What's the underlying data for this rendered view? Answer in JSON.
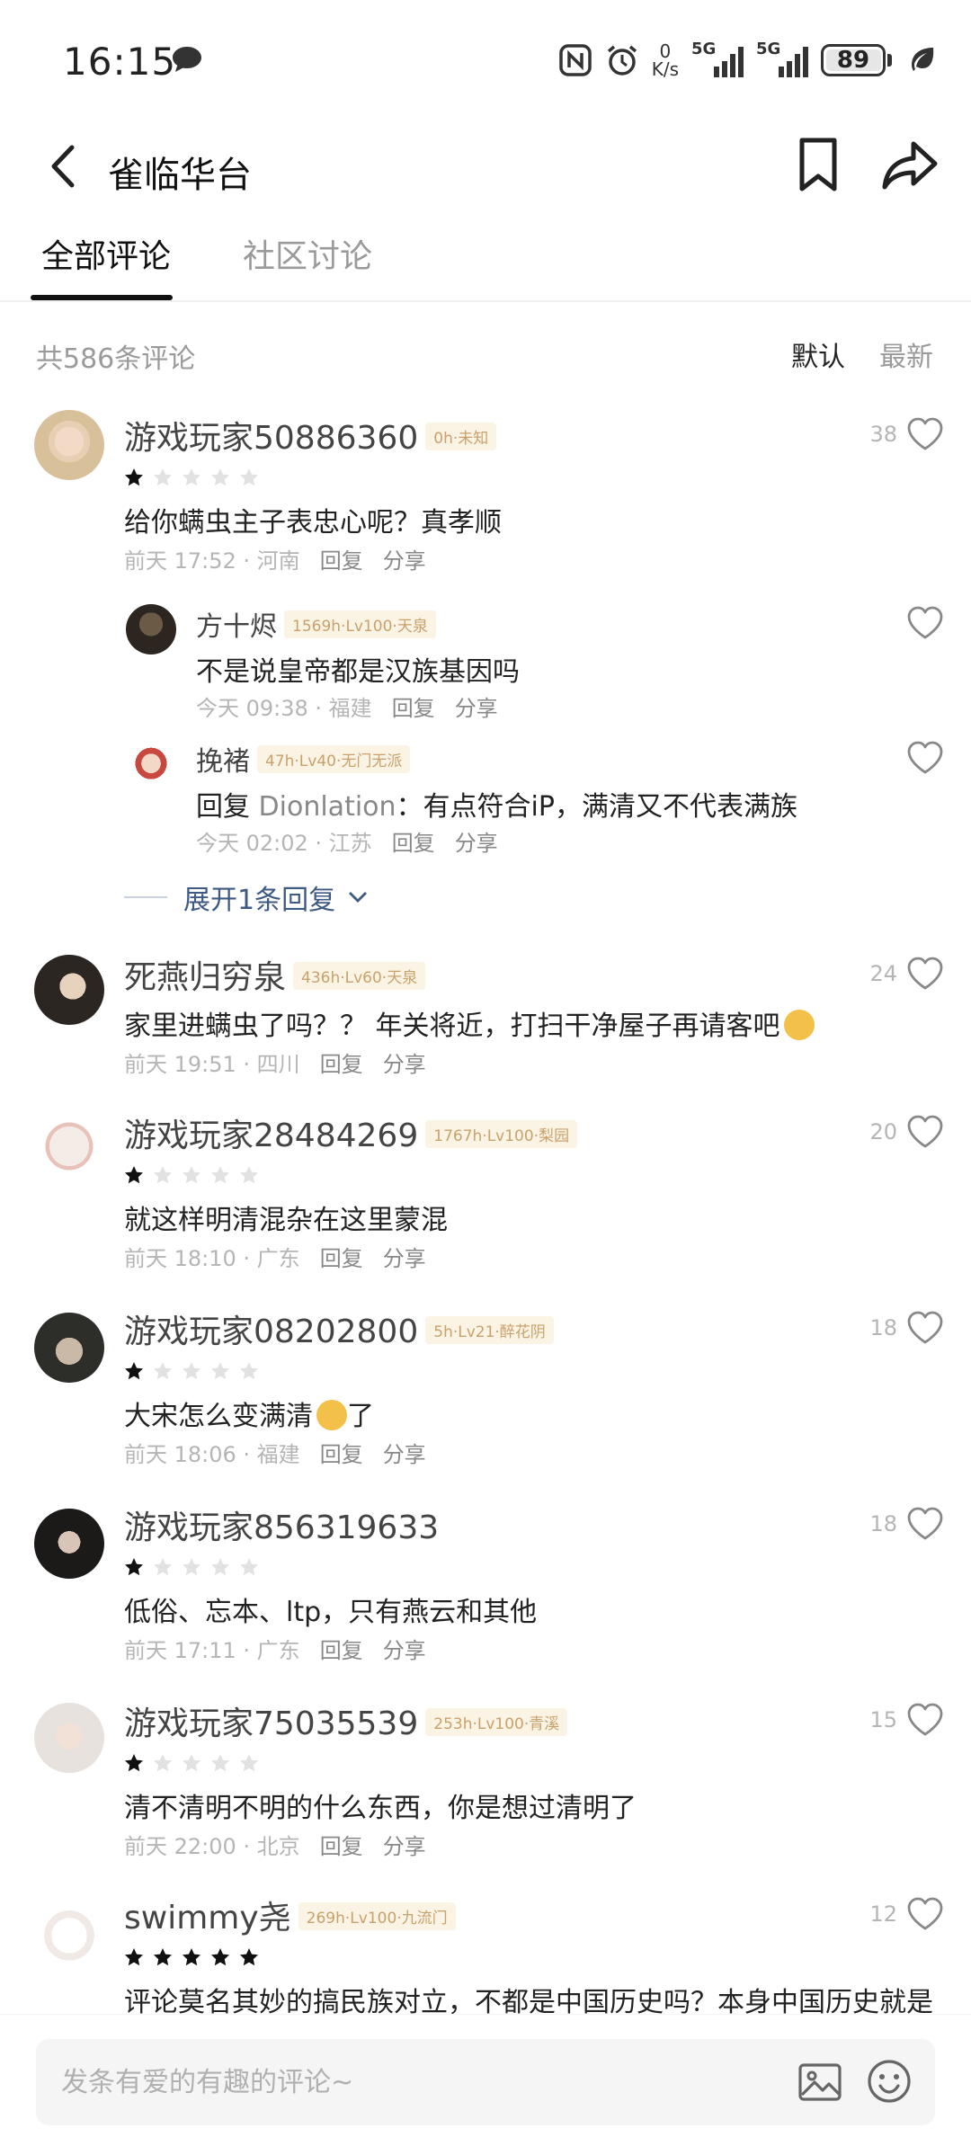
{
  "status_bar": {
    "time": "16:15",
    "net_speed_value": "0",
    "net_speed_unit": "K/s",
    "signal1_label": "5G",
    "signal2_label": "5G",
    "battery_level": "89"
  },
  "header": {
    "title": "雀临华台"
  },
  "tabs": [
    {
      "label": "全部评论",
      "active": true
    },
    {
      "label": "社区讨论",
      "active": false
    }
  ],
  "sort": {
    "count_text": "共586条评论",
    "default_label": "默认",
    "newest_label": "最新"
  },
  "comments": [
    {
      "username": "游戏玩家50886360",
      "tag": "0h·未知",
      "stars": 1,
      "text": "给你螨虫主子表忠心呢？真孝顺",
      "time_location": "前天 17:52 · 河南",
      "reply_label": "回复",
      "share_label": "分享",
      "likes": "38",
      "replies": [
        {
          "username": "方十烬",
          "tag": "1569h·Lv100·天泉",
          "text": "不是说皇帝都是汉族基因吗",
          "time_location": "今天 09:38 · 福建",
          "reply_label": "回复",
          "share_label": "分享"
        },
        {
          "username": "挽褚",
          "tag": "47h·Lv40·无门无派",
          "quote_prefix": "回复 ",
          "quote_user": "Dionlation",
          "text": "：有点符合iP，满清又不代表满族",
          "time_location": "今天 02:02 · 江苏",
          "reply_label": "回复",
          "share_label": "分享"
        }
      ],
      "expand_label": "展开1条回复"
    },
    {
      "username": "死燕归穷泉",
      "tag": "436h·Lv60·天泉",
      "text": "家里进螨虫了吗？？ 年关将近，打扫干净屋子再请客吧",
      "time_location": "前天 19:51 · 四川",
      "reply_label": "回复",
      "share_label": "分享",
      "likes": "24"
    },
    {
      "username": "游戏玩家28484269",
      "tag": "1767h·Lv100·梨园",
      "stars": 1,
      "text": "就这样明清混杂在这里蒙混",
      "time_location": "前天 18:10 · 广东",
      "reply_label": "回复",
      "share_label": "分享",
      "likes": "20"
    },
    {
      "username": "游戏玩家08202800",
      "tag": "5h·Lv21·醉花阴",
      "stars": 1,
      "text_before_emoji": "大宋怎么变满清",
      "text_after_emoji": "了",
      "time_location": "前天 18:06 · 福建",
      "reply_label": "回复",
      "share_label": "分享",
      "likes": "18"
    },
    {
      "username": "游戏玩家856319633",
      "stars": 1,
      "text": "低俗、忘本、ltp，只有燕云和其他",
      "time_location": "前天 17:11 · 广东",
      "reply_label": "回复",
      "share_label": "分享",
      "likes": "18"
    },
    {
      "username": "游戏玩家75035539",
      "tag": "253h·Lv100·青溪",
      "stars": 1,
      "text": "清不清明不明的什么东西，你是想过清明了",
      "time_location": "前天 22:00 · 北京",
      "reply_label": "回复",
      "share_label": "分享",
      "likes": "15"
    },
    {
      "username": "swimmy尧",
      "tag": "269h·Lv100·九流门",
      "stars": 5,
      "text": "评论莫名其妙的搞民族对立，不都是中国历史吗？本身中国历史就是",
      "likes": "12"
    }
  ],
  "input": {
    "placeholder": "发条有爱的有趣的评论~"
  },
  "colors": {
    "tag_text": "#c8a26c",
    "tag_bg": "#fbf3e4",
    "link": "#3e5a84",
    "muted": "#b5b5b5"
  }
}
